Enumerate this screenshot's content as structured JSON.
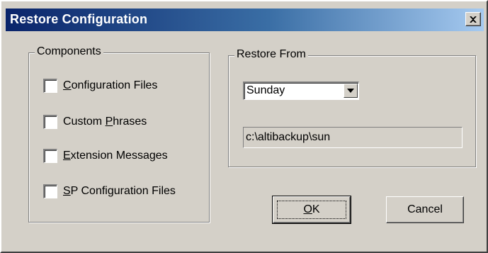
{
  "window": {
    "title": "Restore Configuration",
    "close_glyph": "×"
  },
  "components": {
    "label": "Components",
    "items": [
      {
        "pre": "",
        "mnemonic": "C",
        "post": "onfiguration Files",
        "checked": false
      },
      {
        "pre": "Custom ",
        "mnemonic": "P",
        "post": "hrases",
        "checked": false
      },
      {
        "pre": "",
        "mnemonic": "E",
        "post": "xtension Messages",
        "checked": false
      },
      {
        "pre": "",
        "mnemonic": "S",
        "post": "P Configuration Files",
        "checked": false
      }
    ]
  },
  "restore_from": {
    "label": "Restore From",
    "selected": "Sunday",
    "path": "c:\\altibackup\\sun"
  },
  "buttons": {
    "ok_mnemonic": "O",
    "ok_rest": "K",
    "cancel": "Cancel"
  },
  "colors": {
    "face": "#d4d0c8",
    "title_start": "#0a246a",
    "title_end": "#a6caf0"
  }
}
